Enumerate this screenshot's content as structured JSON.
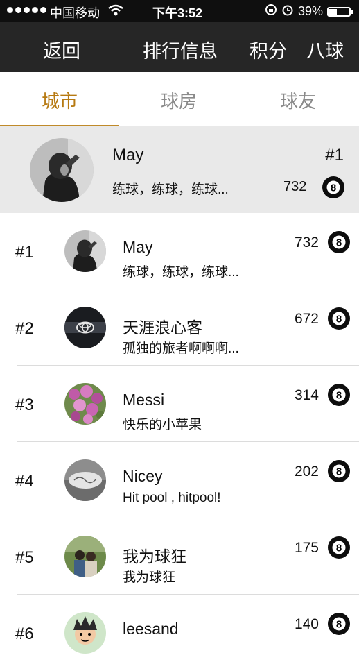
{
  "status_bar": {
    "carrier": "中国移动",
    "time": "下午3:52",
    "battery": "39%",
    "battery_level": 0.39
  },
  "navbar": {
    "back_label": "返回",
    "title": "排行信息",
    "points_label": "积分",
    "game_label": "八球"
  },
  "tabs": [
    {
      "label": "城市",
      "active": true
    },
    {
      "label": "球房",
      "active": false
    },
    {
      "label": "球友",
      "active": false
    }
  ],
  "my_rank": {
    "name": "May",
    "rank": "#1",
    "signature": "练球，练球，练球...",
    "score": "732",
    "avatar": "woman-hand-on-head"
  },
  "leaderboard": [
    {
      "rank": "#1",
      "name": "May",
      "signature": "练球，练球，练球...",
      "score": "732",
      "avatar": "woman-hand-on-head"
    },
    {
      "rank": "#2",
      "name": "天涯浪心客",
      "signature": "孤独的旅者啊啊啊...",
      "score": "672",
      "avatar": "car-logo"
    },
    {
      "rank": "#3",
      "name": "Messi",
      "signature": "快乐的小苹果",
      "score": "314",
      "avatar": "pink-flowers"
    },
    {
      "rank": "#4",
      "name": "Nicey",
      "signature": "Hit  pool , hitpool!",
      "score": "202",
      "avatar": "gray-object"
    },
    {
      "rank": "#5",
      "name": "我为球狂",
      "signature": "我为球狂",
      "score": "175",
      "avatar": "two-people-outdoors"
    },
    {
      "rank": "#6",
      "name": "leesand",
      "signature": "",
      "score": "140",
      "avatar": "cartoon-face"
    }
  ],
  "colors": {
    "accent": "#b77a12",
    "navbar_bg": "#262626",
    "status_bg": "#0f0f0f",
    "highlight_bg": "#e9e9e9"
  },
  "icons": {
    "ball": "eight-ball-icon",
    "ball_number": "8"
  }
}
